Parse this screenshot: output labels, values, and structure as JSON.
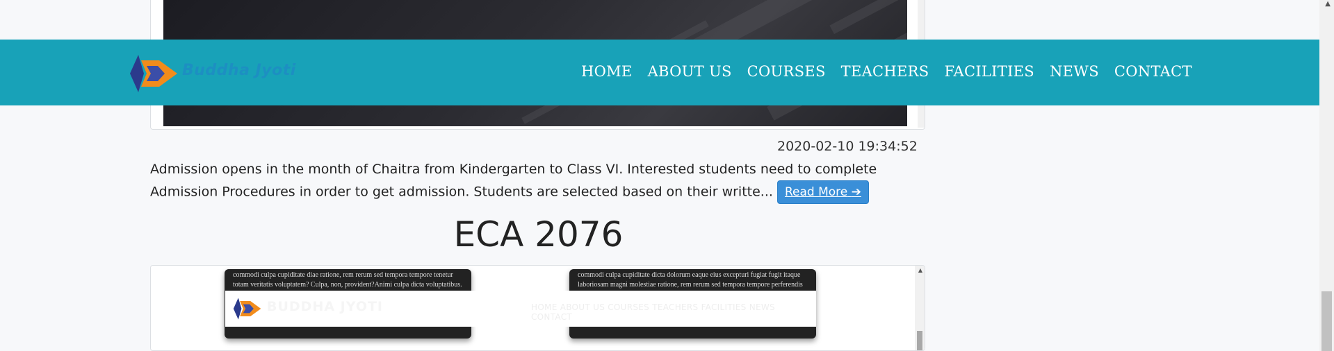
{
  "navbar": {
    "brand": "Buddha Jyoti",
    "links": [
      "HOME",
      "ABOUT US",
      "COURSES",
      "TEACHERS",
      "FACILITIES",
      "NEWS",
      "CONTACT"
    ],
    "bg_color": "#18a2b8"
  },
  "news": {
    "date": "2020-02-10 19:34:52",
    "excerpt": "Admission opens in the month of Chaitra from Kindergarten to Class VI. Interested students need to complete Admission Procedures in order to get admission. Students are selected based on their writte...",
    "read_more": "Read More",
    "read_more_icon": "arrow-right-icon"
  },
  "eca": {
    "heading": "ECA 2076",
    "panel_left_text": "commodi culpa cupiditate diae ratione, rem rerum sed tempora tempore tenetur totam veritatis voluptatem? Culpa, non, provident?Animi culpa dicta voluptatibus.",
    "panel_right_text": "commodi culpa cupiditate dicta dolorum eaque eius excepturi fugiat fugit itaque laboriosam magni molestiae ratione, rem rerum sed tempora tempore perferendis",
    "mini_brand": "BUDDHA JYOTI",
    "mini_nav": "HOME  ABOUT US  COURSES  TEACHERS  FACILITIES  NEWS  CONTACT"
  }
}
